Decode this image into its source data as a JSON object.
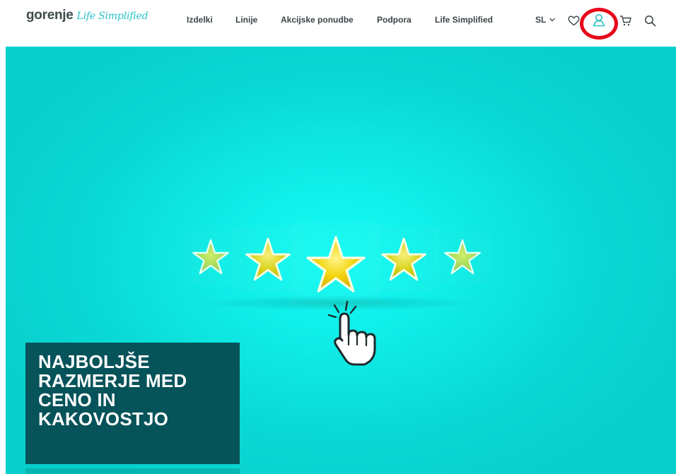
{
  "header": {
    "logo": {
      "brand": "gorenje",
      "tagline": "Life Simplified"
    },
    "nav": [
      {
        "label": "Izdelki"
      },
      {
        "label": "Linije"
      },
      {
        "label": "Akcijske ponudbe"
      },
      {
        "label": "Podpora"
      },
      {
        "label": "Life Simplified"
      }
    ],
    "language": {
      "selected": "SL"
    },
    "icons": [
      "heart-icon",
      "user-icon",
      "cart-icon",
      "search-icon"
    ],
    "highlighted_icon": "user-icon"
  },
  "hero": {
    "rating": {
      "value": 3,
      "max": 5
    },
    "headline_lines": [
      "NAJBOLJŠE",
      "RAZMERJE MED",
      "CENO IN",
      "KAKOVOSTJO"
    ]
  },
  "colors": {
    "brand_teal": "#26c1c6",
    "hero_background": "#0ad8d5",
    "promo_box": "#06535a",
    "highlight_ring": "#e8081a",
    "nav_text": "#3a4447"
  }
}
